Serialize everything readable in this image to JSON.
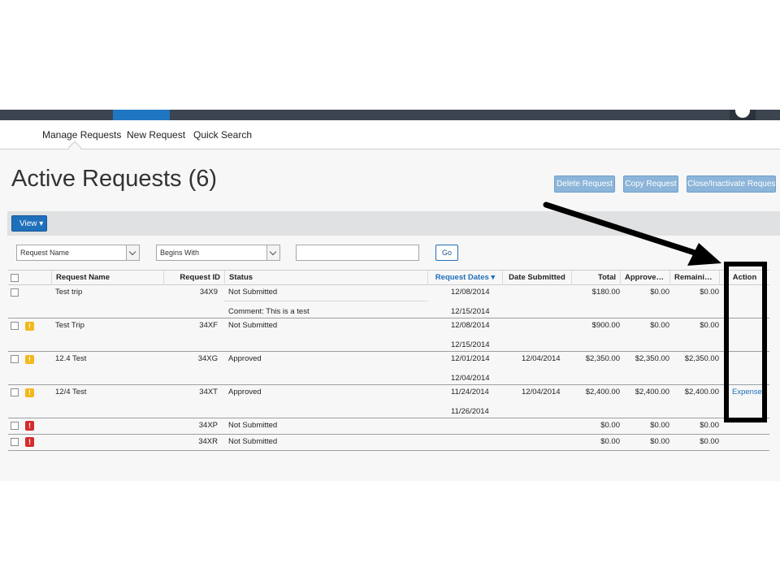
{
  "nav": {
    "items": [
      "Manage Requests",
      "New Request",
      "Quick Search"
    ]
  },
  "page": {
    "title": "Active Requests (6)"
  },
  "buttons": {
    "delete": "Delete Request",
    "copy": "Copy Request",
    "close": "Close/Inactivate Request",
    "view": "View ▾",
    "go": "Go"
  },
  "filters": {
    "field": "Request Name",
    "operator": "Begins With",
    "value": ""
  },
  "table": {
    "headers": {
      "name": "Request Name",
      "id": "Request ID",
      "status": "Status",
      "dates": "Request Dates ▾",
      "submitted": "Date Submitted",
      "total": "Total",
      "approved": "Approve…",
      "remaining": "Remaini…",
      "action": "Action"
    },
    "rows": [
      {
        "name": "Test trip",
        "id": "34X9",
        "status": "Not Submitted",
        "comment": "Comment: This is a test",
        "date1": "12/08/2014",
        "date2": "12/15/2014",
        "submitted": "",
        "total": "$180.00",
        "approved": "$0.00",
        "remaining": "$0.00",
        "action": ""
      },
      {
        "name": "Test Trip",
        "id": "34XF",
        "status": "Not Submitted",
        "comment": "",
        "date1": "12/08/2014",
        "date2": "12/15/2014",
        "submitted": "",
        "total": "$900.00",
        "approved": "$0.00",
        "remaining": "$0.00",
        "action": ""
      },
      {
        "name": "12.4 Test",
        "id": "34XG",
        "status": "Approved",
        "comment": "",
        "date1": "12/01/2014",
        "date2": "12/04/2014",
        "submitted": "12/04/2014",
        "total": "$2,350.00",
        "approved": "$2,350.00",
        "remaining": "$2,350.00",
        "action": ""
      },
      {
        "name": "12/4 Test",
        "id": "34XT",
        "status": "Approved",
        "comment": "",
        "date1": "11/24/2014",
        "date2": "11/26/2014",
        "submitted": "12/04/2014",
        "total": "$2,400.00",
        "approved": "$2,400.00",
        "remaining": "$2,400.00",
        "action": "Expense"
      },
      {
        "name": "",
        "id": "34XP",
        "status": "Not Submitted",
        "comment": "",
        "date1": "",
        "date2": "",
        "submitted": "",
        "total": "$0.00",
        "approved": "$0.00",
        "remaining": "$0.00",
        "action": ""
      },
      {
        "name": "",
        "id": "34XR",
        "status": "Not Submitted",
        "comment": "",
        "date1": "",
        "date2": "",
        "submitted": "",
        "total": "$0.00",
        "approved": "$0.00",
        "remaining": "$0.00",
        "action": ""
      }
    ]
  },
  "colors": {
    "accent": "#1f6fba",
    "topbar": "#3b444f",
    "warning": "#f2b81c",
    "error": "#d62b2b"
  },
  "icons": {
    "warning": "warning-icon",
    "error": "error-icon"
  }
}
